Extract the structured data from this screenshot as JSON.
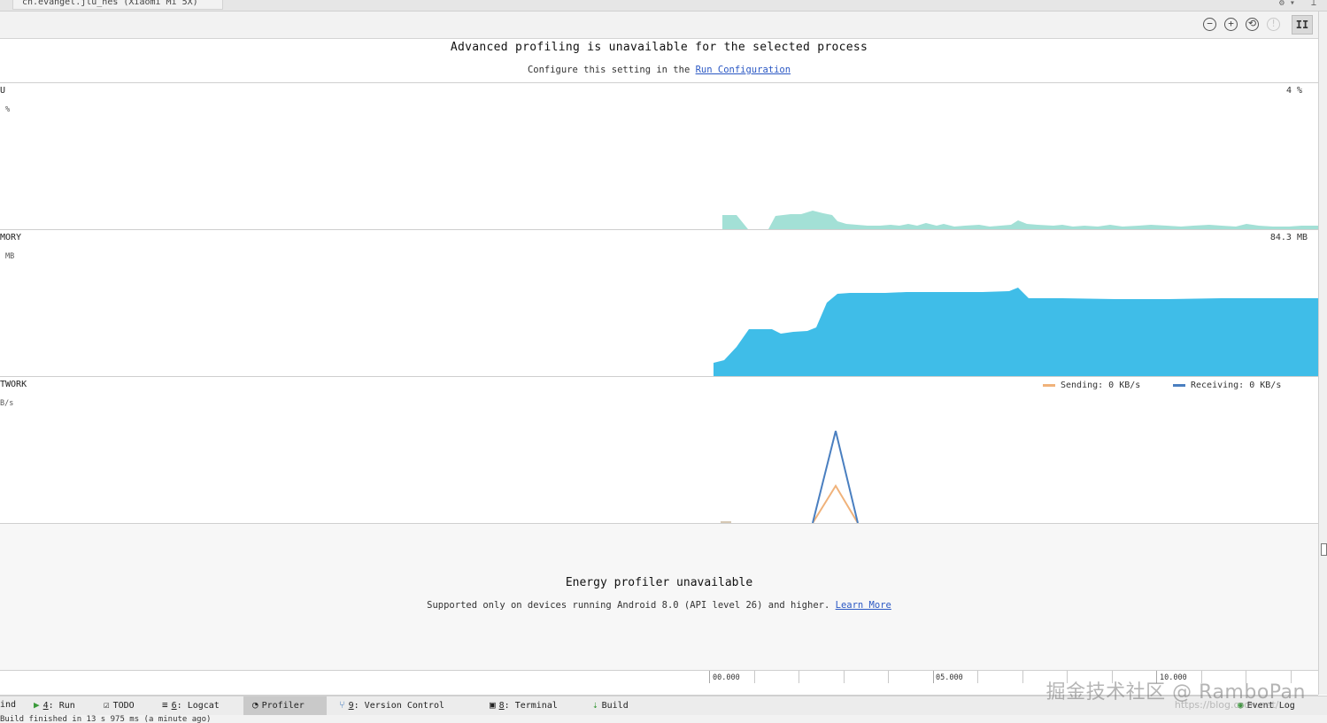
{
  "session_tab": {
    "label": "cn.evangel.jlu_nes (Xiaomi Mi 5X)"
  },
  "toolbar": {
    "zoom_out": "−",
    "zoom_in": "+",
    "reset_zoom": "⟲",
    "attach": "!",
    "pause": "II"
  },
  "banner": {
    "title": "Advanced profiling is unavailable for the selected process",
    "sub_prefix": "Configure this setting in the ",
    "sub_link": "Run Configuration"
  },
  "cpu": {
    "label": "U",
    "axis": "%",
    "value": "4 %",
    "color": "#a3e0d6"
  },
  "memory": {
    "label": "MORY",
    "axis": "MB",
    "value": "84.3 MB",
    "color": "#3fbde8"
  },
  "network": {
    "label": "TWORK",
    "axis": "B/s",
    "sending": "Sending: 0 KB/s",
    "receiving": "Receiving: 0 KB/s",
    "sending_color": "#f0b27a",
    "receiving_color": "#4a7fc0"
  },
  "energy": {
    "title": "Energy profiler unavailable",
    "sub_prefix": "Supported only on devices running Android 8.0 (API level 26) and higher. ",
    "sub_link": "Learn More"
  },
  "timeline": {
    "labels": [
      "00.000",
      "05.000",
      "10.000"
    ]
  },
  "tool_windows": [
    {
      "prefix": "ind",
      "num": "",
      "label": "",
      "icon": ""
    },
    {
      "prefix": "",
      "num": "4",
      "label": ": Run",
      "icon": "▶"
    },
    {
      "prefix": "",
      "num": "",
      "label": "TODO",
      "icon": "☑"
    },
    {
      "prefix": "",
      "num": "6",
      "label": ": Logcat",
      "icon": "≡"
    },
    {
      "prefix": "",
      "num": "",
      "label": "Profiler",
      "icon": "◔"
    },
    {
      "prefix": "",
      "num": "9",
      "label": ": Version Control",
      "icon": "⑂"
    },
    {
      "prefix": "",
      "num": "8",
      "label": ": Terminal",
      "icon": "▣"
    },
    {
      "prefix": "",
      "num": "",
      "label": "Build",
      "icon": "⇣"
    },
    {
      "prefix": "",
      "num": "",
      "label": "Event Log",
      "icon": "◉"
    }
  ],
  "status": {
    "text": "Build finished in 13 s 975 ms (a minute ago)"
  },
  "watermark": {
    "text": "掘金技术社区 @ RamboPan",
    "url": "https://blog.csdn.net/..."
  }
}
